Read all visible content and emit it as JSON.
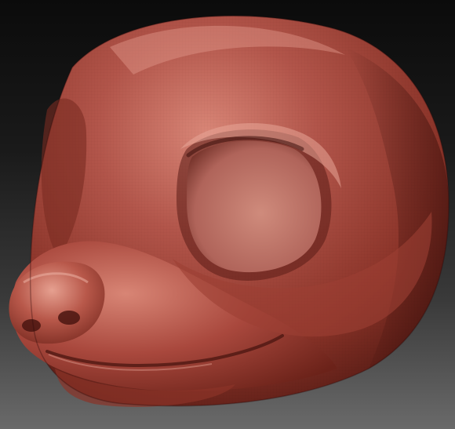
{
  "scene": {
    "subject": "sculpted-animal-head-bust",
    "material_colors": {
      "base": "#a84a3e",
      "highlight": "#e9a69a",
      "shadow": "#4a1712",
      "deep_shadow": "#2a0a08",
      "eye_socket": "#c8806f"
    },
    "background": {
      "top": "#0b0b0b",
      "bottom": "#6a6a6a"
    }
  }
}
